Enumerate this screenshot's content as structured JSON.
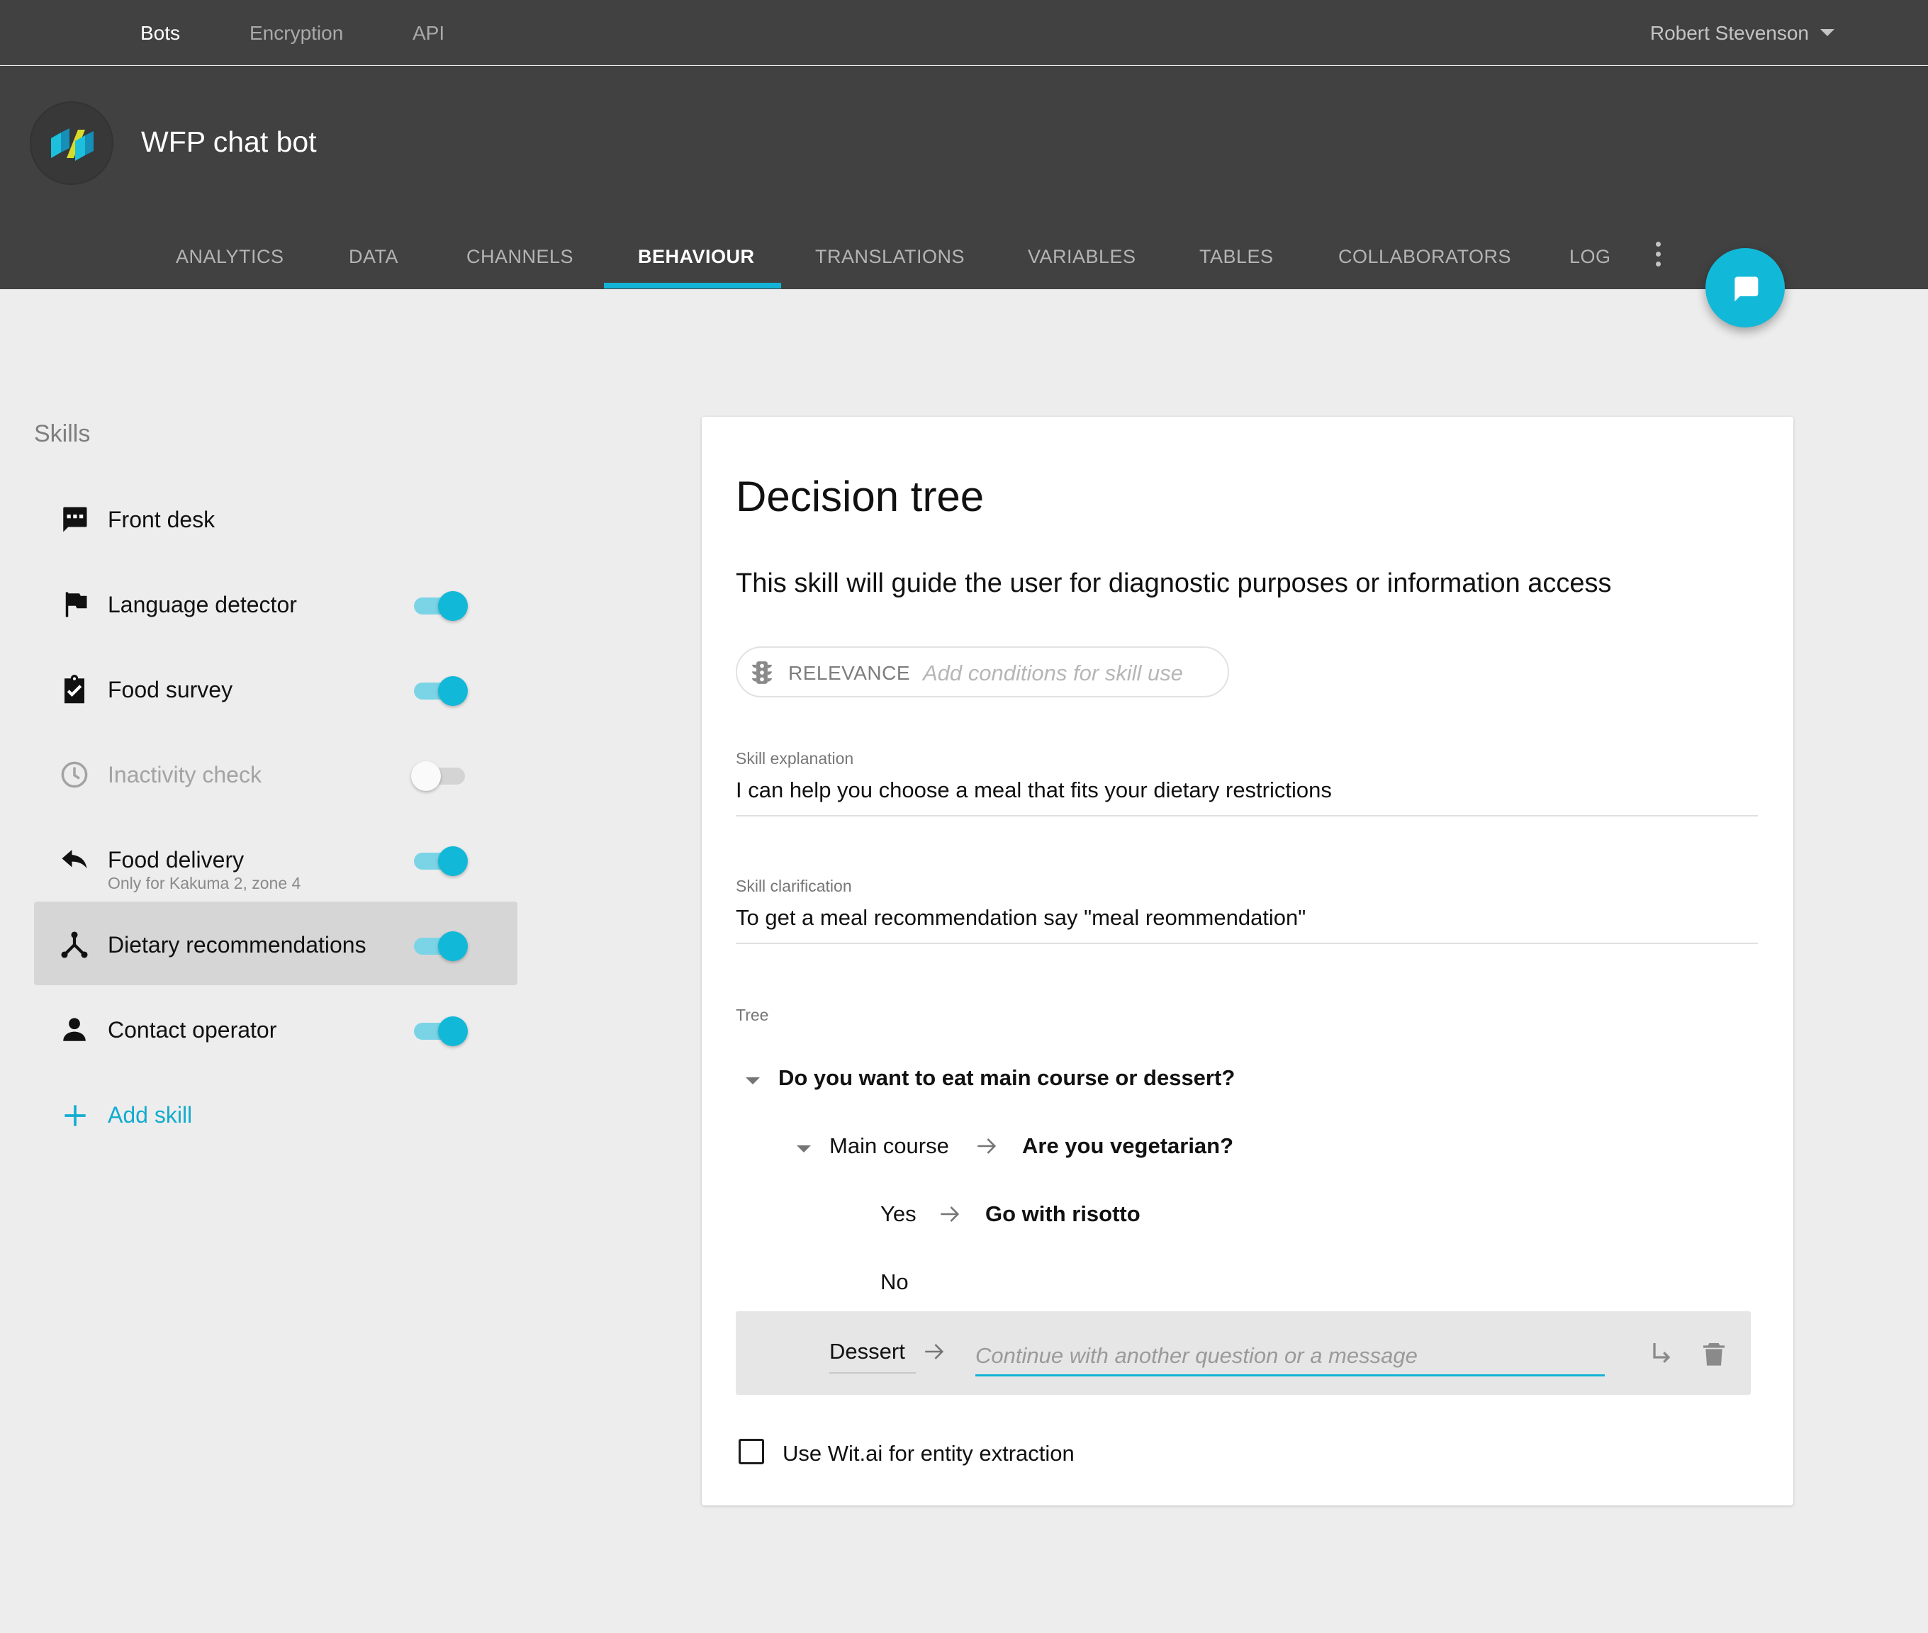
{
  "topnav": {
    "items": [
      {
        "label": "Bots"
      },
      {
        "label": "Encryption"
      },
      {
        "label": "API"
      }
    ],
    "user_name": "Robert Stevenson"
  },
  "header": {
    "bot_title": "WFP chat bot",
    "tabs": [
      {
        "label": "ANALYTICS"
      },
      {
        "label": "DATA"
      },
      {
        "label": "CHANNELS"
      },
      {
        "label": "BEHAVIOUR"
      },
      {
        "label": "TRANSLATIONS"
      },
      {
        "label": "VARIABLES"
      },
      {
        "label": "TABLES"
      },
      {
        "label": "COLLABORATORS"
      },
      {
        "label": "LOG"
      }
    ],
    "active_tab": "BEHAVIOUR"
  },
  "sidebar": {
    "heading": "Skills",
    "skills": [
      {
        "label": "Front desk",
        "icon": "chat-icon",
        "has_toggle": false
      },
      {
        "label": "Language detector",
        "icon": "flag-icon",
        "enabled": true
      },
      {
        "label": "Food survey",
        "icon": "clipboard-check-icon",
        "enabled": true
      },
      {
        "label": "Inactivity check",
        "icon": "clock-icon",
        "enabled": false
      },
      {
        "label": "Food delivery",
        "icon": "reply-icon",
        "enabled": true,
        "subtitle": "Only for Kakuma 2, zone 4"
      },
      {
        "label": "Dietary recommendations",
        "icon": "decision-tree-icon",
        "enabled": true,
        "selected": true
      },
      {
        "label": "Contact operator",
        "icon": "person-icon",
        "enabled": true
      }
    ],
    "add_skill_label": "Add skill"
  },
  "card": {
    "title": "Decision tree",
    "subtitle": "This skill will guide the user for diagnostic purposes or information access",
    "relevance": {
      "label": "RELEVANCE",
      "placeholder": "Add conditions for skill use"
    },
    "skill_explanation": {
      "label": "Skill explanation",
      "value": "I can help you choose a meal that fits your dietary restrictions"
    },
    "skill_clarification": {
      "label": "Skill clarification",
      "value": "To get a meal recommendation say \"meal reommendation\""
    },
    "tree": {
      "label": "Tree",
      "root_question": "Do you want to eat main course or dessert?",
      "main_course": {
        "answer": "Main course",
        "question": "Are you vegetarian?",
        "yes_answer": "Yes",
        "yes_result": "Go with risotto",
        "no_answer": "No"
      },
      "dessert": {
        "answer": "Dessert",
        "next_placeholder": "Continue with another question or a message"
      }
    },
    "wit_checkbox": {
      "label": "Use Wit.ai for entity extraction",
      "checked": false
    }
  },
  "colors": {
    "accent": "#12b3d6",
    "topbar": "#414141",
    "background": "#ededed"
  }
}
